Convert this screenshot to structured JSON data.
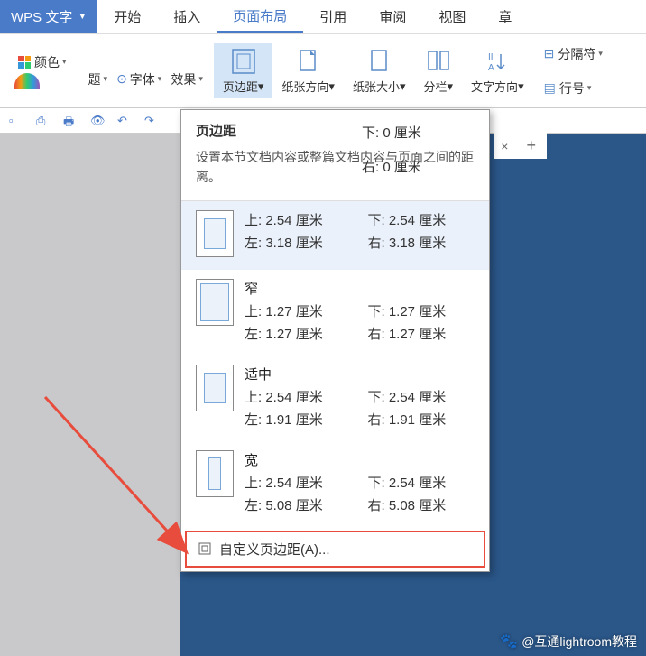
{
  "app": {
    "title": "WPS 文字"
  },
  "menuTabs": [
    "开始",
    "插入",
    "页面布局",
    "引用",
    "审阅",
    "视图",
    "章"
  ],
  "activeTab": 2,
  "ribbon": {
    "color": "颜色",
    "theme": "题",
    "font": "字体",
    "effect": "效果",
    "margin": "页边距",
    "orientation": "纸张方向",
    "size": "纸张大小",
    "columns": "分栏",
    "textDir": "文字方向",
    "breaks": "分隔符",
    "lineNum": "行号"
  },
  "dropdown": {
    "title": "页边距",
    "desc": "设置本节文档内容或整篇文档内容与页面之间的距离。",
    "extraTop": "下: 0 厘米",
    "extraRight": "右: 0 厘米",
    "presets": [
      {
        "name": "",
        "iconClass": "normal",
        "selected": true,
        "top": "上: 2.54 厘米",
        "bottom": "下: 2.54 厘米",
        "left": "左: 3.18 厘米",
        "right": "右: 3.18 厘米"
      },
      {
        "name": "窄",
        "iconClass": "narrow",
        "selected": false,
        "top": "上: 1.27 厘米",
        "bottom": "下: 1.27 厘米",
        "left": "左: 1.27 厘米",
        "right": "右: 1.27 厘米"
      },
      {
        "name": "适中",
        "iconClass": "normal",
        "selected": false,
        "top": "上: 2.54 厘米",
        "bottom": "下: 2.54 厘米",
        "left": "左: 1.91 厘米",
        "right": "右: 1.91 厘米"
      },
      {
        "name": "宽",
        "iconClass": "wide",
        "selected": false,
        "top": "上: 2.54 厘米",
        "bottom": "下: 2.54 厘米",
        "left": "左: 5.08 厘米",
        "right": "右: 5.08 厘米"
      }
    ],
    "custom": "自定义页边距(A)..."
  },
  "watermark": "@互通lightroom教程"
}
